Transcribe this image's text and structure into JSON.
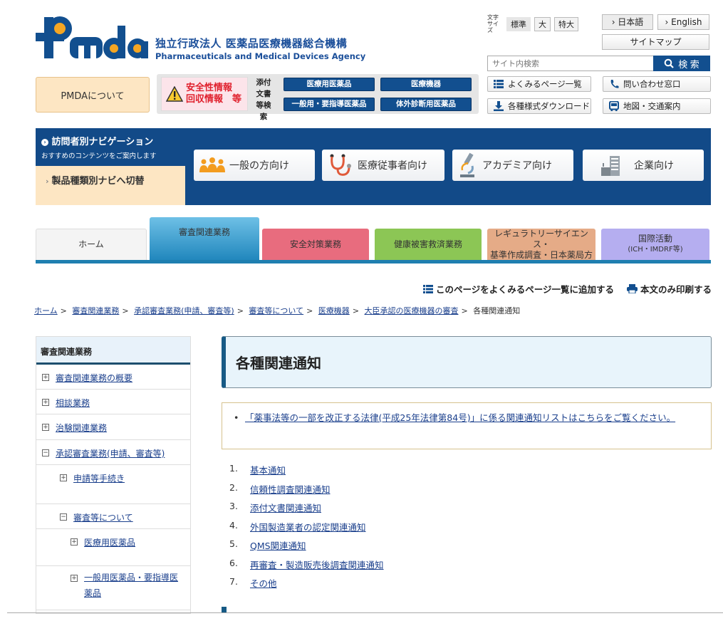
{
  "header": {
    "logo_text": "Pmda",
    "org_name_jp": "独立行政法人 医薬品医療機器総合機構",
    "org_name_en": "Pharmaceuticals and Medical Devices Agency",
    "font_size_label": "文字サイズ",
    "font_sizes": [
      "標準",
      "大",
      "特大"
    ],
    "languages": [
      "› 日本語",
      "› English"
    ],
    "sitemap": "サイトマップ",
    "search": {
      "placeholder": "サイト内検索",
      "button": "検 索"
    }
  },
  "quick": {
    "about": "PMDAについて",
    "safety_line1": "安全性情報",
    "safety_line2": "回収情報　等",
    "doc_search_label": "添付文書等検索",
    "doc_buttons": [
      "医療用医薬品",
      "医療機器",
      "一般用・要指導医薬品",
      "体外診断用医薬品"
    ],
    "utility": [
      {
        "label": "よくみるページ一覧",
        "icon": "list-icon"
      },
      {
        "label": "問い合わせ窓口",
        "icon": "phone-icon"
      },
      {
        "label": "各種様式ダウンロード",
        "icon": "download-icon"
      },
      {
        "label": "地図・交通案内",
        "icon": "train-icon"
      }
    ]
  },
  "visitor_nav": {
    "title": "訪問者別ナビゲーション",
    "subtitle": "おすすめのコンテンツをご案内します",
    "switch": "製品種類別ナビへ切替",
    "audiences": [
      {
        "label": "一般の方向け",
        "icon": "people-icon"
      },
      {
        "label": "医療従事者向け",
        "icon": "stethoscope-icon"
      },
      {
        "label": "アカデミア向け",
        "icon": "microscope-icon"
      },
      {
        "label": "企業向け",
        "icon": "building-icon"
      }
    ]
  },
  "tabs": [
    {
      "label": "ホーム",
      "sub": "",
      "color": "#f4f4f4"
    },
    {
      "label": "審査関連業務",
      "sub": "",
      "color": "#2e95c8",
      "active": true
    },
    {
      "label": "安全対策業務",
      "sub": "",
      "color": "#e86c7e"
    },
    {
      "label": "健康被害救済業務",
      "sub": "",
      "color": "#8cc655"
    },
    {
      "label": "レギュラトリーサイエンス・",
      "sub": "基準作成調査・日本薬局方",
      "color": "#e5ab87"
    },
    {
      "label": "国際活動",
      "sub": "(ICH・IMDRF等)",
      "color": "#b5aef0"
    }
  ],
  "page_tools": {
    "add_favorite": "このページをよくみるページ一覧に追加する",
    "print": "本文のみ印刷する"
  },
  "breadcrumb": {
    "items": [
      "ホーム",
      "審査関連業務",
      "承認審査業務(申請、審査等)",
      "審査等について",
      "医療機器",
      "大臣承認の医療機器の審査"
    ],
    "current": "各種関連通知",
    "separator": ">"
  },
  "sidebar": {
    "title": "審査関連業務",
    "items": [
      {
        "label": "審査関連業務の概要",
        "state": "+",
        "level": 0
      },
      {
        "label": "相談業務",
        "state": "+",
        "level": 0
      },
      {
        "label": "治験関連業務",
        "state": "+",
        "level": 0
      },
      {
        "label": "承認審査業務(申請、審査等)",
        "state": "−",
        "level": 0
      },
      {
        "label": "申請等手続き",
        "state": "+",
        "level": 1
      },
      {
        "label": "審査等について",
        "state": "−",
        "level": 1
      },
      {
        "label": "医療用医薬品",
        "state": "+",
        "level": 2
      },
      {
        "label": "一般用医薬品・要指導医薬品",
        "state": "+",
        "level": 2
      }
    ]
  },
  "main": {
    "title": "各種関連通知",
    "notice": "「薬事法等の一部を改正する法律(平成25年法律第84号)」に係る関連通知リストはこちらをご覧ください。",
    "list": [
      "基本通知",
      "信頼性調査関連通知",
      "添付文書関連通知",
      "外国製造業者の認定関連通知",
      "QMS関連通知",
      "再審査・製造販売後調査関連通知",
      "その他"
    ]
  },
  "colors": {
    "brand_blue": "#124f8f",
    "brand_orange": "#f5a623",
    "link": "#1a3f8c"
  }
}
